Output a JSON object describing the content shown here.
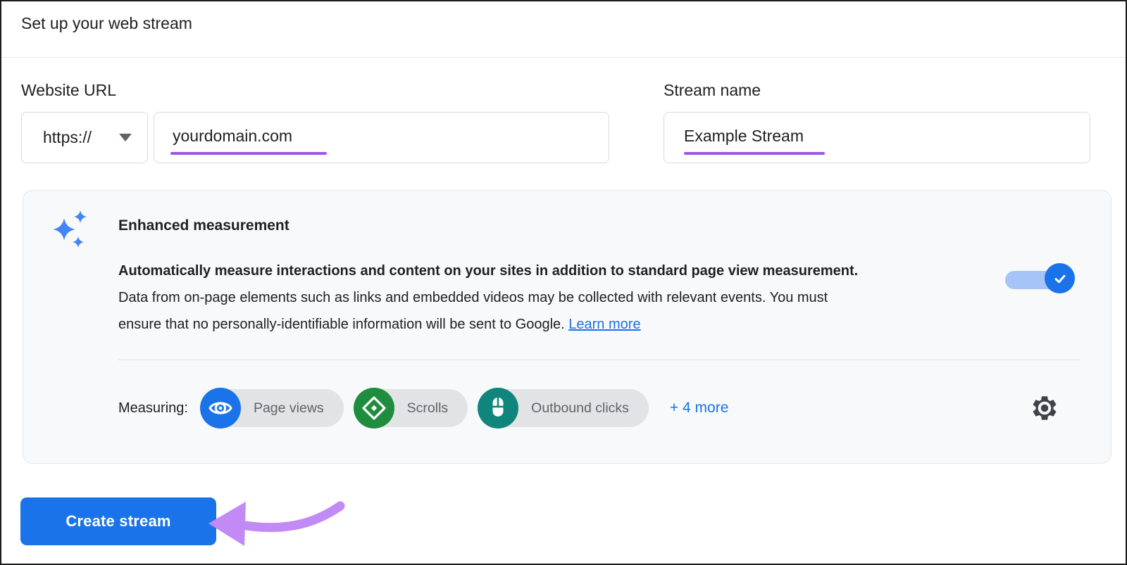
{
  "window": {
    "title": "Set up your web stream"
  },
  "form": {
    "website_url": {
      "label": "Website URL",
      "protocol_value": "https://",
      "value": "yourdomain.com"
    },
    "stream_name": {
      "label": "Stream name",
      "value": "Example Stream"
    }
  },
  "enhanced_measurement": {
    "title": "Enhanced measurement",
    "description_lines": [
      "Automatically measure interactions and content on your sites in addition to standard page view measurement.",
      "Data from on-page elements such as links and embedded videos may be collected with relevant events. You must",
      "ensure that no personally-identifiable information will be sent to Google."
    ],
    "learn_more_label": "Learn more",
    "toggle_state": "on",
    "measuring_label": "Measuring:",
    "chips": [
      {
        "label": "Page views",
        "icon": "eye-icon",
        "color": "#1a73e8"
      },
      {
        "label": "Scrolls",
        "icon": "scroll-icon",
        "color": "#1e8e3e"
      },
      {
        "label": "Outbound clicks",
        "icon": "mouse-icon",
        "color": "#0f857c"
      }
    ],
    "more_label": "+ 4 more"
  },
  "actions": {
    "create_stream_label": "Create stream"
  },
  "colors": {
    "accent_blue": "#1a73e8",
    "toggle_track_blue": "#a6c4f7",
    "input_underline_purple": "#9c57e5",
    "annotation_arrow_purple": "#c18af5",
    "card_background": "#f8f9fa",
    "chip_background": "#e2e3e5",
    "text_primary": "#202124",
    "text_secondary": "#5f6368",
    "sparkle_blue": "#4285f4"
  }
}
